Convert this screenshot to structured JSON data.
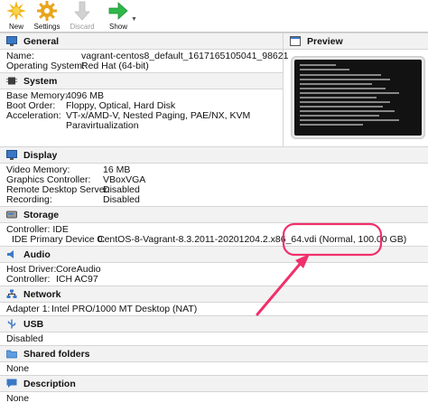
{
  "toolbar": {
    "new_label": "New",
    "settings_label": "Settings",
    "discard_label": "Discard",
    "show_label": "Show",
    "dropdown_glyph": "▼"
  },
  "general": {
    "title": "General",
    "name_label": "Name:",
    "name_value": "vagrant-centos8_default_1617165105041_98621",
    "os_label": "Operating System:",
    "os_value": "Red Hat (64-bit)"
  },
  "preview": {
    "title": "Preview"
  },
  "system": {
    "title": "System",
    "memory_label": "Base Memory:",
    "memory_value": "4096 MB",
    "boot_label": "Boot Order:",
    "boot_value": "Floppy, Optical, Hard Disk",
    "accel_label": "Acceleration:",
    "accel_value_1": "VT-x/AMD-V, Nested Paging, PAE/NX, KVM",
    "accel_value_2": "Paravirtualization"
  },
  "display": {
    "title": "Display",
    "video_label": "Video Memory:",
    "video_value": "16 MB",
    "graphics_label": "Graphics Controller:",
    "graphics_value": "VBoxVGA",
    "rds_label": "Remote Desktop Server:",
    "rds_value": "Disabled",
    "recording_label": "Recording:",
    "recording_value": "Disabled"
  },
  "storage": {
    "title": "Storage",
    "controller_label": "Controller: IDE",
    "device_label": "IDE Primary Device 0:",
    "device_value": "CentOS-8-Vagrant-8.3.2011-20201204.2.x86_64.vdi (Normal, 100.00 GB)"
  },
  "audio": {
    "title": "Audio",
    "host_label": "Host Driver:",
    "host_value": "CoreAudio",
    "controller_label": "Controller:",
    "controller_value": "ICH AC97"
  },
  "network": {
    "title": "Network",
    "adapter_label": "Adapter 1:",
    "adapter_value": "Intel PRO/1000 MT Desktop (NAT)"
  },
  "usb": {
    "title": "USB",
    "value": "Disabled"
  },
  "shared": {
    "title": "Shared folders",
    "value": "None"
  },
  "description": {
    "title": "Description",
    "value": "None"
  },
  "colors": {
    "annotation": "#f0306b",
    "section_icon": "#3a78c6",
    "header_bg": "#f2f2f2"
  }
}
